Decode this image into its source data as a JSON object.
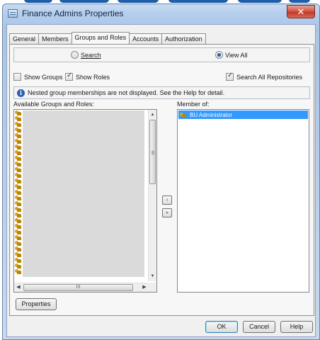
{
  "window": {
    "title": "Finance Admins Properties",
    "close_glyph": "✕"
  },
  "tabs": [
    {
      "label": "General",
      "active": false
    },
    {
      "label": "Members",
      "active": false
    },
    {
      "label": "Groups and Roles",
      "active": true
    },
    {
      "label": "Accounts",
      "active": false
    },
    {
      "label": "Authorization",
      "active": false
    }
  ],
  "mode": {
    "search_label": "Search",
    "view_all_label": "View All",
    "selected": "view_all"
  },
  "filters": {
    "show_groups": {
      "label": "Show Groups",
      "checked": false
    },
    "show_roles": {
      "label": "Show Roles",
      "checked": true
    },
    "search_all": {
      "label": "Search All Repositories",
      "checked": true
    }
  },
  "info_message": "Nested group memberships are not displayed. See the Help for detail.",
  "available": {
    "label": "Available Groups and Roles:",
    "hscroll_grip": "III"
  },
  "member_of": {
    "label": "Member of:",
    "items": [
      {
        "name": "BU Administrator",
        "selected": true
      }
    ]
  },
  "transfer": {
    "add_glyph": "›",
    "add_all_glyph": "»"
  },
  "buttons": {
    "properties": "Properties",
    "ok": "OK",
    "cancel": "Cancel",
    "help": "Help"
  }
}
